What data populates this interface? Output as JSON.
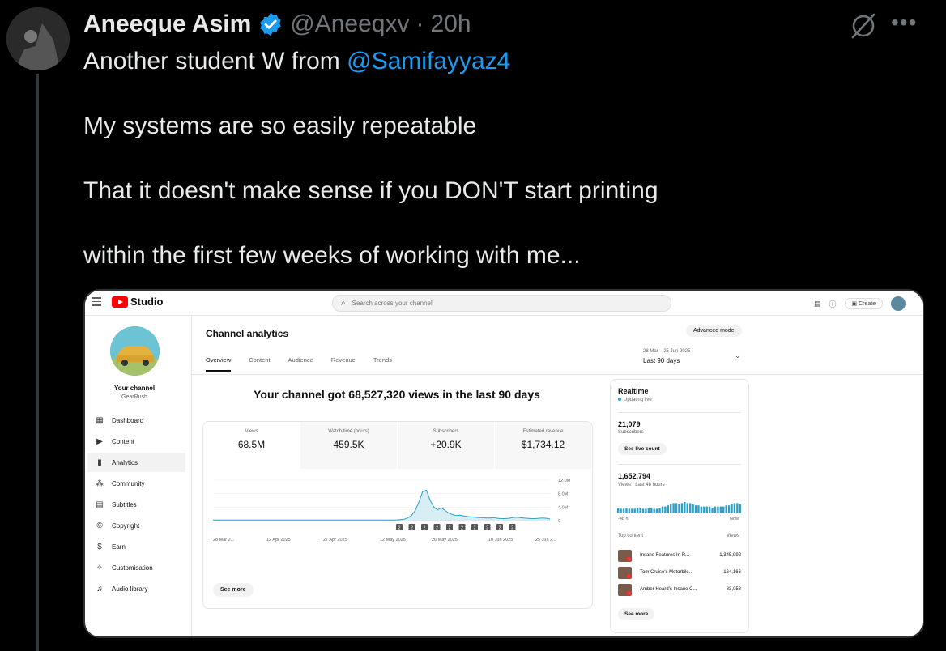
{
  "tweet": {
    "author_name": "Aneeque Asim",
    "handle": "@Aneeqxv",
    "separator": "·",
    "time": "20h",
    "lines": [
      {
        "text": "Another student W from ",
        "mention": "@Samifayyaz4"
      },
      {
        "text": "My systems are so easily repeatable"
      },
      {
        "text": "That it doesn't make sense if you DON'T start printing"
      },
      {
        "text": "within the first few weeks of working with me..."
      }
    ],
    "icons": [
      "verified-badge-icon",
      "grok-icon",
      "more-icon"
    ]
  },
  "studio": {
    "logo": "Studio",
    "search_placeholder": "Search across your channel",
    "create_label": "Create",
    "channel": {
      "label": "Your channel",
      "name": "GearRush"
    },
    "nav": [
      {
        "icon": "dashboard-icon",
        "glyph": "▦",
        "label": "Dashboard"
      },
      {
        "icon": "content-icon",
        "glyph": "▶",
        "label": "Content"
      },
      {
        "icon": "analytics-icon",
        "glyph": "▮",
        "label": "Analytics",
        "active": true
      },
      {
        "icon": "community-icon",
        "glyph": "⁂",
        "label": "Community"
      },
      {
        "icon": "subtitles-icon",
        "glyph": "▤",
        "label": "Subtitles"
      },
      {
        "icon": "copyright-icon",
        "glyph": "©",
        "label": "Copyright"
      },
      {
        "icon": "earn-icon",
        "glyph": "$",
        "label": "Earn"
      },
      {
        "icon": "customisation-icon",
        "glyph": "✧",
        "label": "Customisation"
      },
      {
        "icon": "audio-library-icon",
        "glyph": "♫",
        "label": "Audio library"
      }
    ],
    "page_title": "Channel analytics",
    "advanced_mode": "Advanced mode",
    "tabs": [
      "Overview",
      "Content",
      "Audience",
      "Revenue",
      "Trends"
    ],
    "date_range": {
      "dates": "28 Mar – 25 Jun 2025",
      "label": "Last 90 days"
    },
    "headline": "Your channel got 68,527,320 views in the last 90 days",
    "kpis": [
      {
        "title": "Views",
        "value": "68.5M"
      },
      {
        "title": "Watch time (hours)",
        "value": "459.5K"
      },
      {
        "title": "Subscribers",
        "value": "+20.9K"
      },
      {
        "title": "Estimated revenue",
        "value": "$1,734.12"
      }
    ],
    "see_more": "See more",
    "realtime": {
      "title": "Realtime",
      "updating": "Updating live",
      "subscribers_value": "21,079",
      "subscribers_label": "Subscribers",
      "live_count_button": "See live count",
      "views_value": "1,652,794",
      "views_label": "Views · Last 48 hours",
      "axis_left": "-48 h",
      "axis_right": "Now",
      "top_content_label": "Top content",
      "views_col": "Views",
      "top_content": [
        {
          "title": "Insane Features In R...",
          "views": "1,345,992"
        },
        {
          "title": "Tom Cruise's Motorbik...",
          "views": "164,166"
        },
        {
          "title": "Amber Heard's Insane C...",
          "views": "83,058"
        }
      ],
      "see_more": "See more",
      "bars": [
        5,
        4,
        4,
        5,
        4,
        4,
        4,
        5,
        5,
        4,
        4,
        5,
        5,
        4,
        4,
        5,
        6,
        6,
        7,
        8,
        9,
        9,
        8,
        9,
        10,
        9,
        9,
        8,
        7,
        7,
        6,
        6,
        6,
        6,
        5,
        6,
        6,
        6,
        6,
        7,
        7,
        8,
        9,
        9,
        8
      ]
    },
    "chart_data": {
      "type": "line",
      "x_tick_labels": [
        "28 Mar 2...",
        "12 Apr 2025",
        "27 Apr 2025",
        "12 May 2025",
        "26 May 2025",
        "10 Jun 2025",
        "25 Jun 2..."
      ],
      "y_tick_labels": [
        "12.0M",
        "8.0M",
        "4.0M",
        "0"
      ],
      "ylim": [
        0,
        12
      ],
      "y_unit": "M",
      "values": [
        0.2,
        0.2,
        0.2,
        0.2,
        0.2,
        0.2,
        0.2,
        0.2,
        0.2,
        0.2,
        0.2,
        0.2,
        0.2,
        0.2,
        0.2,
        0.2,
        0.2,
        0.2,
        0.2,
        0.2,
        0.2,
        0.2,
        0.2,
        0.2,
        0.2,
        0.2,
        0.2,
        0.2,
        0.2,
        0.2,
        0.2,
        0.2,
        0.2,
        0.2,
        0.2,
        0.2,
        0.2,
        0.2,
        0.2,
        0.2,
        0.2,
        0.2,
        0.2,
        0.2,
        0.2,
        0.2,
        0.2,
        0.2,
        0.2,
        0.2,
        0.3,
        0.4,
        0.8,
        1.5,
        3.0,
        5.5,
        8.6,
        9.0,
        6.0,
        4.0,
        3.2,
        3.8,
        3.0,
        2.2,
        1.8,
        1.5,
        1.6,
        1.4,
        1.2,
        1.1,
        1.0,
        0.9,
        0.9,
        0.8,
        0.8,
        0.9,
        0.7,
        0.6,
        0.6,
        0.7,
        0.9,
        1.0,
        0.9,
        0.8,
        0.7,
        0.6,
        0.6,
        0.7,
        0.8,
        0.7,
        0.5
      ],
      "markers": [
        "2",
        "2",
        "2",
        "2",
        "2",
        "2",
        "2",
        "2",
        "2",
        "2"
      ]
    }
  }
}
